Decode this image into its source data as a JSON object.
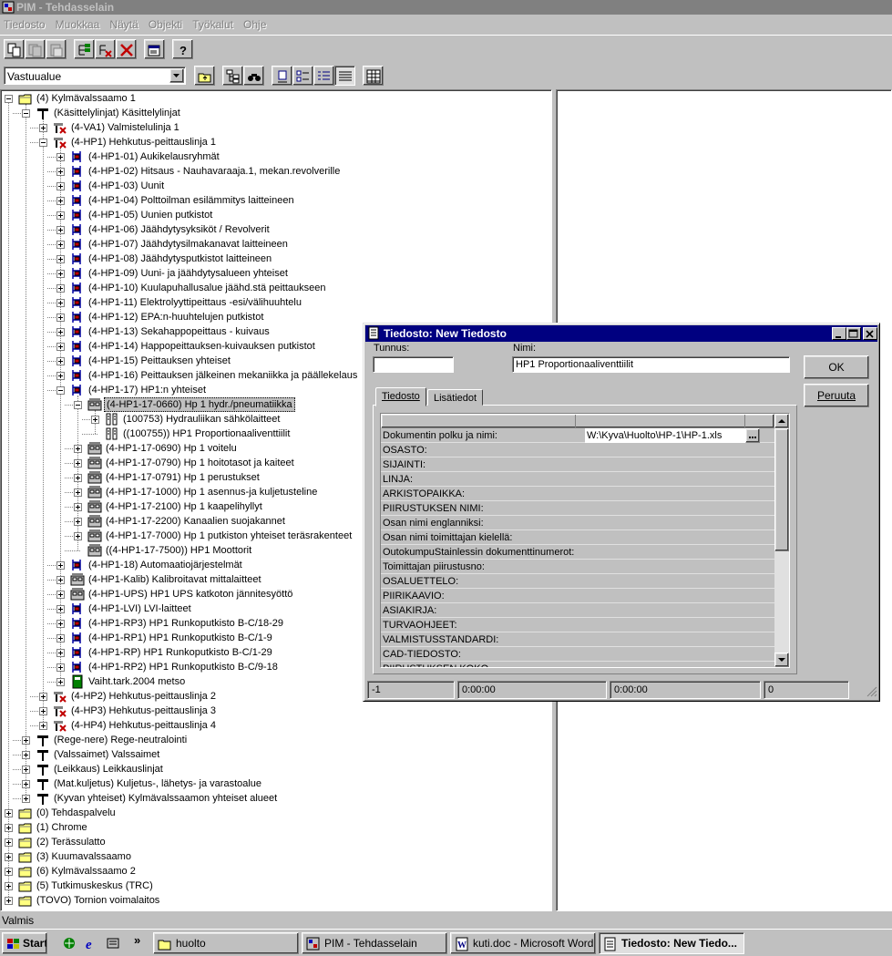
{
  "window": {
    "title": "PIM - Tehdasselain"
  },
  "menu": [
    "Tiedosto",
    "Muokkaa",
    "Näytä",
    "Objekti",
    "Työkalut",
    "Ohje"
  ],
  "toolbar": {
    "buttons": [
      "copy-icon",
      "copy-object-icon",
      "paste-icon",
      "new-tree-icon",
      "remove-link-icon",
      "delete-icon",
      "properties-icon",
      "help-icon"
    ]
  },
  "toolbar2": {
    "combo_value": "Vastuualue",
    "buttons": [
      "up-folder-icon",
      "tree-view-icon",
      "find-icon",
      "large-icons-icon",
      "small-icons-icon",
      "list-icon",
      "details-icon",
      "grid-icon"
    ]
  },
  "tree": [
    {
      "level": 0,
      "exp": "minus",
      "icon": "folder",
      "label": "(4)  Kylmävalssaamo 1"
    },
    {
      "level": 1,
      "exp": "minus",
      "icon": "tee",
      "label": "(Käsittelylinjat)  Käsittelylinjat"
    },
    {
      "level": 2,
      "exp": "plus",
      "icon": "line",
      "label": "(4-VA1)  Valmistelulinja 1"
    },
    {
      "level": 2,
      "exp": "minus",
      "icon": "line",
      "label": "(4-HP1)  Hehkutus-peittauslinja 1"
    },
    {
      "level": 3,
      "exp": "plus",
      "icon": "equip",
      "label": "(4-HP1-01)  Aukikelausryhmät"
    },
    {
      "level": 3,
      "exp": "plus",
      "icon": "equip",
      "label": "(4-HP1-02)  Hitsaus - Nauhavaraaja.1, mekan.revolverille"
    },
    {
      "level": 3,
      "exp": "plus",
      "icon": "equip",
      "label": "(4-HP1-03)  Uunit"
    },
    {
      "level": 3,
      "exp": "plus",
      "icon": "equip",
      "label": "(4-HP1-04)  Polttoilman esilämmitys laitteineen"
    },
    {
      "level": 3,
      "exp": "plus",
      "icon": "equip",
      "label": "(4-HP1-05)  Uunien putkistot"
    },
    {
      "level": 3,
      "exp": "plus",
      "icon": "equip",
      "label": "(4-HP1-06)  Jäähdytysyksiköt / Revolverit"
    },
    {
      "level": 3,
      "exp": "plus",
      "icon": "equip",
      "label": "(4-HP1-07)  Jäähdytysilmakanavat laitteineen"
    },
    {
      "level": 3,
      "exp": "plus",
      "icon": "equip",
      "label": "(4-HP1-08)  Jäähdytysputkistot laitteineen"
    },
    {
      "level": 3,
      "exp": "plus",
      "icon": "equip",
      "label": "(4-HP1-09)  Uuni- ja jäähdytysalueen yhteiset"
    },
    {
      "level": 3,
      "exp": "plus",
      "icon": "equip",
      "label": "(4-HP1-10)  Kuulapuhallusalue jäähd.stä peittaukseen"
    },
    {
      "level": 3,
      "exp": "plus",
      "icon": "equip",
      "label": "(4-HP1-11)  Elektrolyyttipeittaus -esi/välihuuhtelu"
    },
    {
      "level": 3,
      "exp": "plus",
      "icon": "equip",
      "label": "(4-HP1-12)  EPA:n-huuhtelujen putkistot"
    },
    {
      "level": 3,
      "exp": "plus",
      "icon": "equip",
      "label": "(4-HP1-13)  Sekahappopeittaus - kuivaus"
    },
    {
      "level": 3,
      "exp": "plus",
      "icon": "equip",
      "label": "(4-HP1-14)  Happopeittauksen-kuivauksen putkistot"
    },
    {
      "level": 3,
      "exp": "plus",
      "icon": "equip",
      "label": "(4-HP1-15)  Peittauksen yhteiset"
    },
    {
      "level": 3,
      "exp": "plus",
      "icon": "equip",
      "label": "(4-HP1-16)  Peittauksen jälkeinen mekaniikka ja päällekelaus"
    },
    {
      "level": 3,
      "exp": "minus",
      "icon": "equip",
      "label": "(4-HP1-17)  HP1:n  yhteiset"
    },
    {
      "level": 4,
      "exp": "minus",
      "icon": "cabinet",
      "label": "(4-HP1-17-0660)  Hp 1 hydr./pneumatiikka",
      "selected": true
    },
    {
      "level": 5,
      "exp": "plus",
      "icon": "doc",
      "label": "(100753)  Hydrauliikan sähkölaitteet"
    },
    {
      "level": 5,
      "exp": "none",
      "icon": "doc",
      "label": "((100755))  HP1 Proportionaaliventtiilit"
    },
    {
      "level": 4,
      "exp": "plus",
      "icon": "cabinet",
      "label": "(4-HP1-17-0690)  Hp 1 voitelu"
    },
    {
      "level": 4,
      "exp": "plus",
      "icon": "cabinet",
      "label": "(4-HP1-17-0790)  Hp 1 hoitotasot ja kaiteet"
    },
    {
      "level": 4,
      "exp": "plus",
      "icon": "cabinet",
      "label": "(4-HP1-17-0791)  Hp 1 perustukset"
    },
    {
      "level": 4,
      "exp": "plus",
      "icon": "cabinet",
      "label": "(4-HP1-17-1000)  Hp 1 asennus-ja kuljetusteline"
    },
    {
      "level": 4,
      "exp": "plus",
      "icon": "cabinet",
      "label": "(4-HP1-17-2100)  Hp 1 kaapelihyllyt"
    },
    {
      "level": 4,
      "exp": "plus",
      "icon": "cabinet",
      "label": "(4-HP1-17-2200)  Kanaalien suojakannet"
    },
    {
      "level": 4,
      "exp": "plus",
      "icon": "cabinet",
      "label": "(4-HP1-17-7000)  Hp 1 putkiston yhteiset teräsrakenteet"
    },
    {
      "level": 4,
      "exp": "none",
      "icon": "cabinet",
      "label": "((4-HP1-17-7500))  HP1 Moottorit"
    },
    {
      "level": 3,
      "exp": "plus",
      "icon": "equip",
      "label": "(4-HP1-18)  Automaatiojärjestelmät"
    },
    {
      "level": 3,
      "exp": "plus",
      "icon": "cabinet",
      "label": "(4-HP1-Kalib)  Kalibroitavat mittalaitteet"
    },
    {
      "level": 3,
      "exp": "plus",
      "icon": "cabinet",
      "label": "(4-HP1-UPS)  HP1 UPS katkoton jännitesyöttö"
    },
    {
      "level": 3,
      "exp": "plus",
      "icon": "equip",
      "label": "(4-HP1-LVI)  LVI-laitteet"
    },
    {
      "level": 3,
      "exp": "plus",
      "icon": "equip",
      "label": "(4-HP1-RP3)  HP1 Runkoputkisto B-C/18-29"
    },
    {
      "level": 3,
      "exp": "plus",
      "icon": "equip",
      "label": "(4-HP1-RP1)  HP1 Runkoputkisto B-C/1-9"
    },
    {
      "level": 3,
      "exp": "plus",
      "icon": "equip",
      "label": "(4-HP1-RP)  HP1 Runkoputkisto B-C/1-29"
    },
    {
      "level": 3,
      "exp": "plus",
      "icon": "equip",
      "label": "(4-HP1-RP2)  HP1 Runkoputkisto B-C/9-18"
    },
    {
      "level": 3,
      "exp": "plus",
      "icon": "book",
      "label": "Vaiht.tark.2004 metso"
    },
    {
      "level": 2,
      "exp": "plus",
      "icon": "line",
      "label": "(4-HP2)  Hehkutus-peittauslinja 2"
    },
    {
      "level": 2,
      "exp": "plus",
      "icon": "line",
      "label": "(4-HP3)  Hehkutus-peittauslinja 3"
    },
    {
      "level": 2,
      "exp": "plus",
      "icon": "line",
      "label": "(4-HP4)  Hehkutus-peittauslinja 4"
    },
    {
      "level": 1,
      "exp": "plus",
      "icon": "tee",
      "label": "(Rege-nere)  Rege-neutralointi"
    },
    {
      "level": 1,
      "exp": "plus",
      "icon": "tee",
      "label": "(Valssaimet)  Valssaimet"
    },
    {
      "level": 1,
      "exp": "plus",
      "icon": "tee",
      "label": "(Leikkaus)  Leikkauslinjat"
    },
    {
      "level": 1,
      "exp": "plus",
      "icon": "tee",
      "label": "(Mat.kuljetus)  Kuljetus-, lähetys- ja varastoalue"
    },
    {
      "level": 1,
      "exp": "plus",
      "icon": "tee",
      "label": "(Kyvan yhteiset)  Kylmävalssaamon yhteiset alueet"
    },
    {
      "level": 0,
      "exp": "plus",
      "icon": "folder",
      "label": "(0)  Tehdaspalvelu"
    },
    {
      "level": 0,
      "exp": "plus",
      "icon": "folder",
      "label": "(1)  Chrome"
    },
    {
      "level": 0,
      "exp": "plus",
      "icon": "folder",
      "label": "(2)  Terässulatto"
    },
    {
      "level": 0,
      "exp": "plus",
      "icon": "folder",
      "label": "(3)  Kuumavalssaamo"
    },
    {
      "level": 0,
      "exp": "plus",
      "icon": "folder",
      "label": "(6)  Kylmävalssaamo 2"
    },
    {
      "level": 0,
      "exp": "plus",
      "icon": "folder",
      "label": "(5)  Tutkimuskeskus (TRC)"
    },
    {
      "level": 0,
      "exp": "plus",
      "icon": "folder",
      "label": "(TOVO)  Tornion voimalaitos"
    }
  ],
  "status": "Valmis",
  "dialog": {
    "title": "Tiedosto: New Tiedosto",
    "tunnus_label": "Tunnus:",
    "tunnus_value": "",
    "nimi_label": "Nimi:",
    "nimi_value": "HP1 Proportionaaliventtiilit",
    "ok_label": "OK",
    "cancel_label": "Peruuta",
    "tabs": [
      "Tiedosto",
      "Lisätiedot"
    ],
    "grid_rows": [
      {
        "key": "Dokumentin polku ja nimi:",
        "value": "W:\\Kyva\\Huolto\\HP-1\\HP-1.xls"
      },
      {
        "key": "OSASTO:",
        "value": ""
      },
      {
        "key": "SIJAINTI:",
        "value": ""
      },
      {
        "key": "LINJA:",
        "value": ""
      },
      {
        "key": "ARKISTOPAIKKA:",
        "value": ""
      },
      {
        "key": "PIIRUSTUKSEN NIMI:",
        "value": ""
      },
      {
        "key": "Osan nimi englanniksi:",
        "value": ""
      },
      {
        "key": "Osan nimi toimittajan kielellä:",
        "value": ""
      },
      {
        "key": "OutokumpuStainlessin dokumenttinumerot:",
        "value": ""
      },
      {
        "key": "Toimittajan piirustusno:",
        "value": ""
      },
      {
        "key": "OSALUETTELO:",
        "value": ""
      },
      {
        "key": "PIIRIKAAVIO:",
        "value": ""
      },
      {
        "key": "ASIAKIRJA:",
        "value": ""
      },
      {
        "key": "TURVAOHJEET:",
        "value": ""
      },
      {
        "key": "VALMISTUSSTANDARDI:",
        "value": ""
      },
      {
        "key": "CAD-TIEDOSTO:",
        "value": ""
      },
      {
        "key": "PIIRUSTUKSEN KOKO",
        "value": ""
      }
    ],
    "status": [
      "-1",
      "0:00:00",
      "0:00:00",
      "0"
    ]
  },
  "taskbar": {
    "start": "Start",
    "tasks": [
      "huolto",
      "PIM - Tehdasselain",
      "kuti.doc - Microsoft Word",
      "Tiedosto: New Tiedo..."
    ]
  }
}
